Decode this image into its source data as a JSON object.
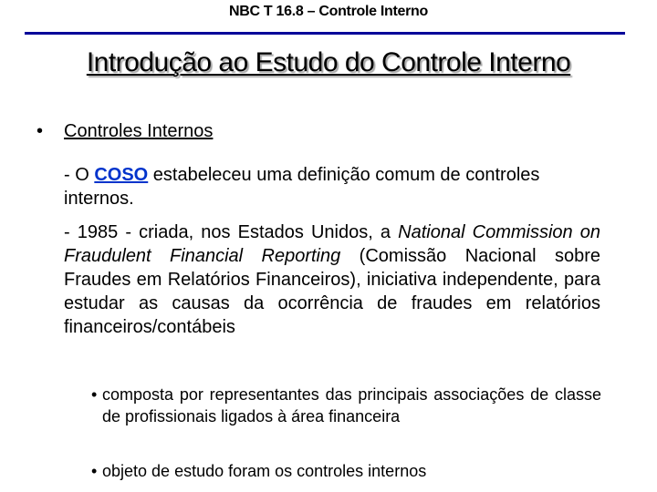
{
  "header": {
    "title": "NBC T 16.8 – Controle Interno"
  },
  "slide": {
    "title": "Introdução ao Estudo do Controle Interno",
    "bullet": {
      "marker": "•",
      "label": "Controles Internos"
    },
    "paragraph1": {
      "prefix": "- O ",
      "link": "COSO",
      "suffix": " estabeleceu uma definição comum de controles internos."
    },
    "paragraph2": {
      "text_before": "- 1985 - criada, nos Estados Unidos, a ",
      "italic": "National Commission on Fraudulent Financial Reporting",
      "text_after": " (Comissão Nacional sobre Fraudes em Relatórios Financeiros), iniciativa independente, para estudar as causas da ocorrência de fraudes em relatórios financeiros/contábeis"
    },
    "sub_bullets": [
      {
        "marker": "•",
        "text": "composta por representantes das principais associações de classe de profissionais ligados à área financeira"
      },
      {
        "marker": "•",
        "text": "objeto de estudo foram os controles internos"
      }
    ]
  },
  "colors": {
    "rule": "#000099",
    "link": "#0033cc"
  }
}
